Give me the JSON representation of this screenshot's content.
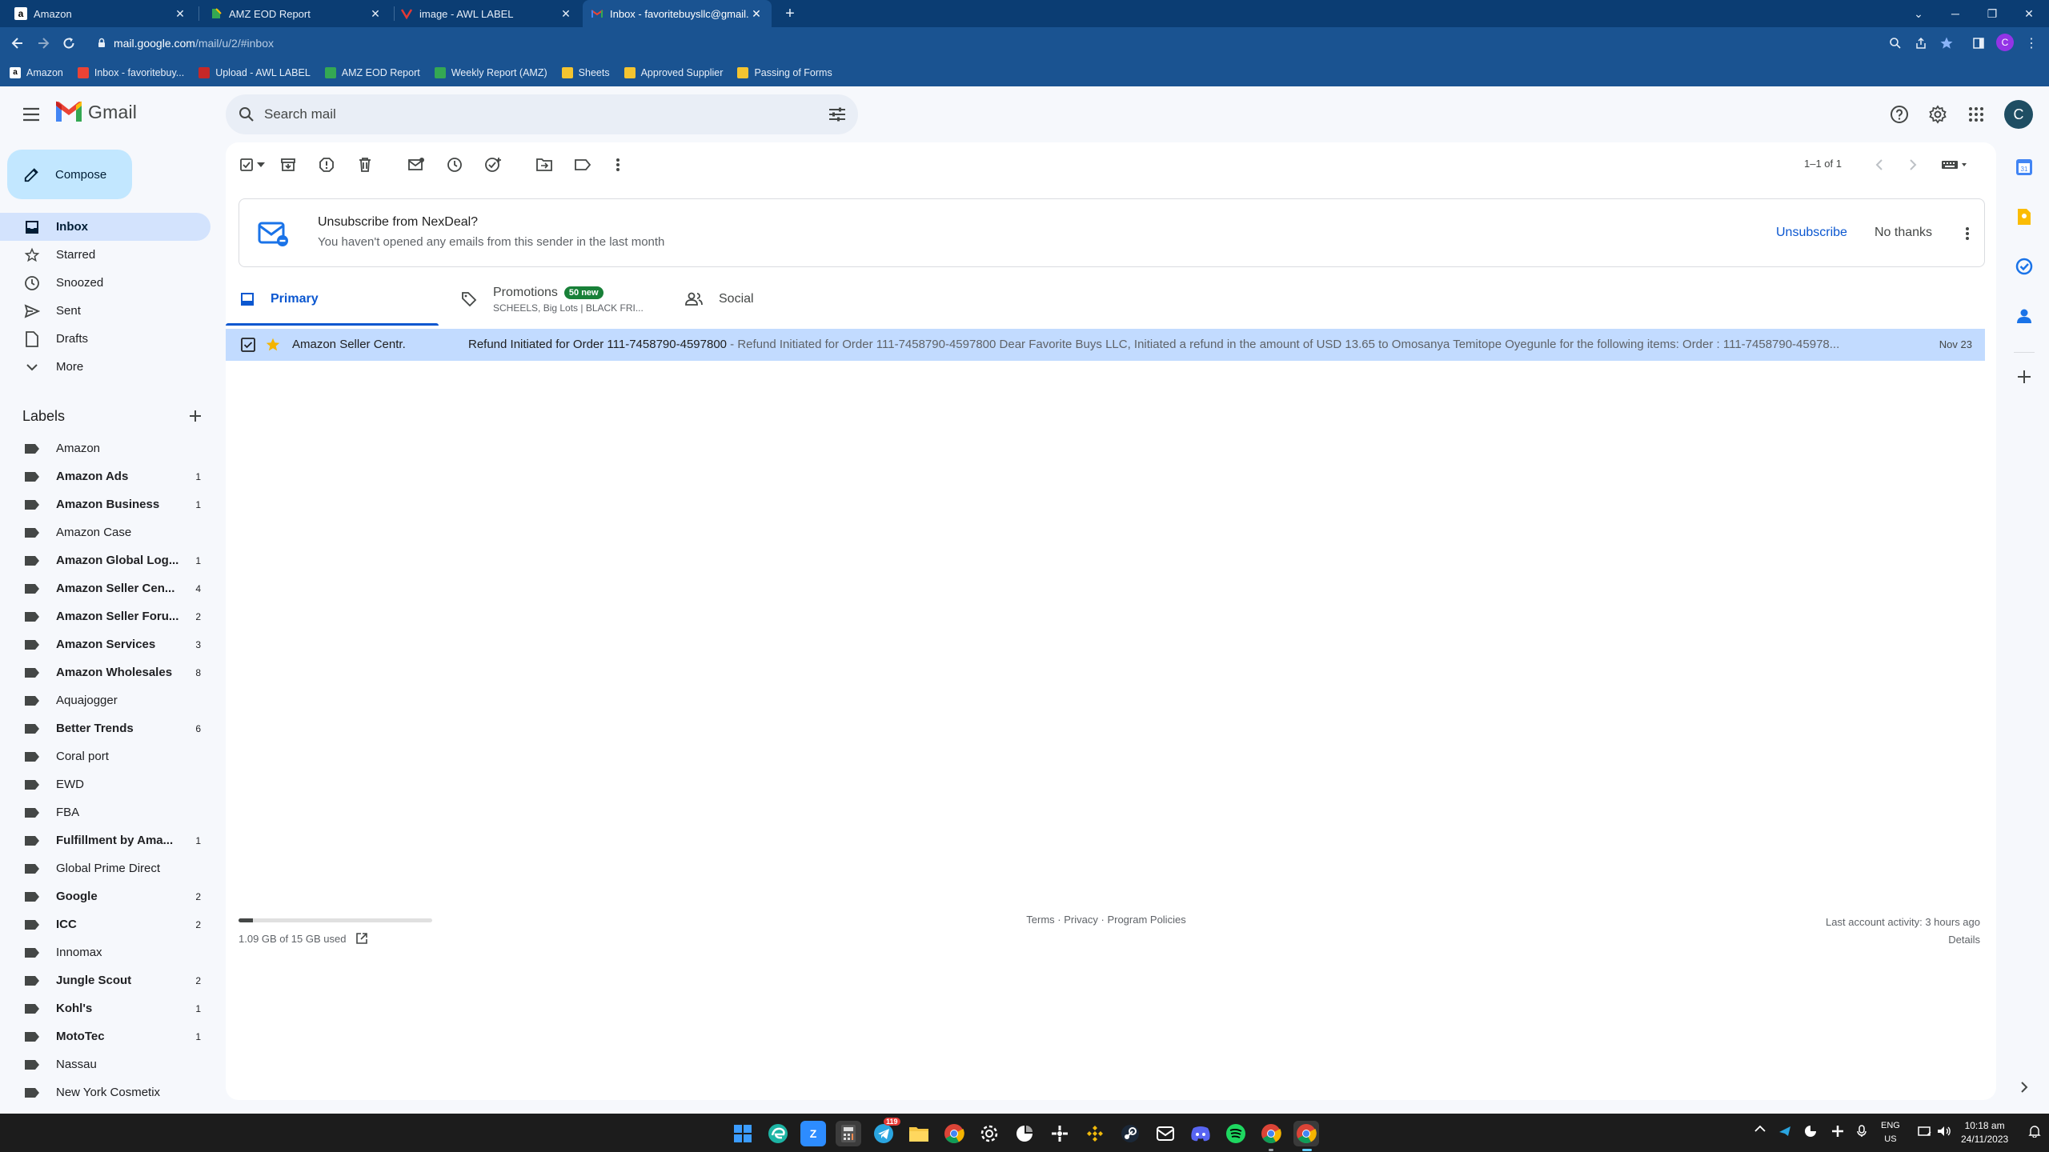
{
  "browser": {
    "tabs": [
      {
        "title": "Amazon",
        "favicon": "amazon-icon"
      },
      {
        "title": "AMZ EOD Report",
        "favicon": "sheets-icon"
      },
      {
        "title": "image - AWL LABEL",
        "favicon": "awl-icon"
      },
      {
        "title": "Inbox - favoritebuysllc@gmail.c",
        "favicon": "gmail-icon"
      }
    ],
    "url_host": "mail.google.com",
    "url_path": "/mail/u/2/#inbox",
    "bookmarks": [
      "Amazon",
      "Inbox - favoritebuy...",
      "Upload - AWL LABEL",
      "AMZ EOD Report",
      "Weekly Report (AMZ)",
      "Sheets",
      "Approved Supplier",
      "Passing of Forms"
    ],
    "profile_initial": "C"
  },
  "gmail": {
    "logo_text": "Gmail",
    "search_placeholder": "Search mail",
    "avatar_initial": "C",
    "compose_label": "Compose",
    "nav": [
      {
        "label": "Inbox",
        "icon": "inbox-icon",
        "active": true
      },
      {
        "label": "Starred",
        "icon": "star-icon"
      },
      {
        "label": "Snoozed",
        "icon": "clock-icon"
      },
      {
        "label": "Sent",
        "icon": "send-icon"
      },
      {
        "label": "Drafts",
        "icon": "draft-icon"
      },
      {
        "label": "More",
        "icon": "chevron-down-icon"
      }
    ],
    "labels_title": "Labels",
    "labels": [
      {
        "name": "Amazon",
        "count": ""
      },
      {
        "name": "Amazon Ads",
        "count": "1"
      },
      {
        "name": "Amazon Business",
        "count": "1"
      },
      {
        "name": "Amazon Case",
        "count": ""
      },
      {
        "name": "Amazon Global Log...",
        "count": "1"
      },
      {
        "name": "Amazon Seller Cen...",
        "count": "4"
      },
      {
        "name": "Amazon Seller Foru...",
        "count": "2"
      },
      {
        "name": "Amazon Services",
        "count": "3"
      },
      {
        "name": "Amazon Wholesales",
        "count": "8"
      },
      {
        "name": "Aquajogger",
        "count": ""
      },
      {
        "name": "Better Trends",
        "count": "6"
      },
      {
        "name": "Coral port",
        "count": ""
      },
      {
        "name": "EWD",
        "count": ""
      },
      {
        "name": "FBA",
        "count": ""
      },
      {
        "name": "Fulfillment by Ama...",
        "count": "1"
      },
      {
        "name": "Global Prime Direct",
        "count": ""
      },
      {
        "name": "Google",
        "count": "2"
      },
      {
        "name": "ICC",
        "count": "2"
      },
      {
        "name": "Innomax",
        "count": ""
      },
      {
        "name": "Jungle Scout",
        "count": "2"
      },
      {
        "name": "Kohl's",
        "count": "1"
      },
      {
        "name": "MotoTec",
        "count": "1"
      },
      {
        "name": "Nassau",
        "count": ""
      },
      {
        "name": "New York Cosmetix",
        "count": ""
      }
    ],
    "pager_text": "1–1 of 1",
    "unsubscribe": {
      "title": "Unsubscribe from NexDeal?",
      "subtitle": "You haven't opened any emails from this sender in the last month",
      "unsubscribe_label": "Unsubscribe",
      "no_thanks_label": "No thanks"
    },
    "tabs": {
      "primary": "Primary",
      "promotions": "Promotions",
      "promotions_badge": "50 new",
      "promotions_sub": "SCHEELS, Big Lots | BLACK FRI...",
      "social": "Social"
    },
    "email": {
      "sender": "Amazon Seller Centr.",
      "subject": "Refund Initiated for Order 111-7458790-4597800",
      "snippet": " - Refund Initiated for Order 111-7458790-4597800 Dear Favorite Buys LLC, Initiated a refund in the amount of USD 13.65 to Omosanya Temitope Oyegunle for the following items: Order : 111-7458790-45978...",
      "date": "Nov 23",
      "checked": true
    },
    "footer": {
      "storage_text": "1.09 GB of 15 GB used",
      "storage_fraction": 0.073,
      "terms": "Terms",
      "privacy": "Privacy",
      "policies": "Program Policies",
      "activity": "Last account activity: 3 hours ago",
      "details": "Details"
    }
  },
  "taskbar": {
    "apps": [
      "start-icon",
      "edge-icon",
      "zoom-icon",
      "calculator-icon",
      "telegram-icon",
      "file-explorer-icon",
      "chrome-icon",
      "settings-icon",
      "app-icon",
      "app-icon",
      "binance-icon",
      "steam-icon",
      "app-icon",
      "discord-icon",
      "spotify-icon",
      "chrome-icon",
      "chrome-icon"
    ],
    "telegram_badge": "119",
    "lang_top": "ENG",
    "lang_bottom": "US",
    "time": "10:18 am",
    "date": "24/11/2023"
  }
}
